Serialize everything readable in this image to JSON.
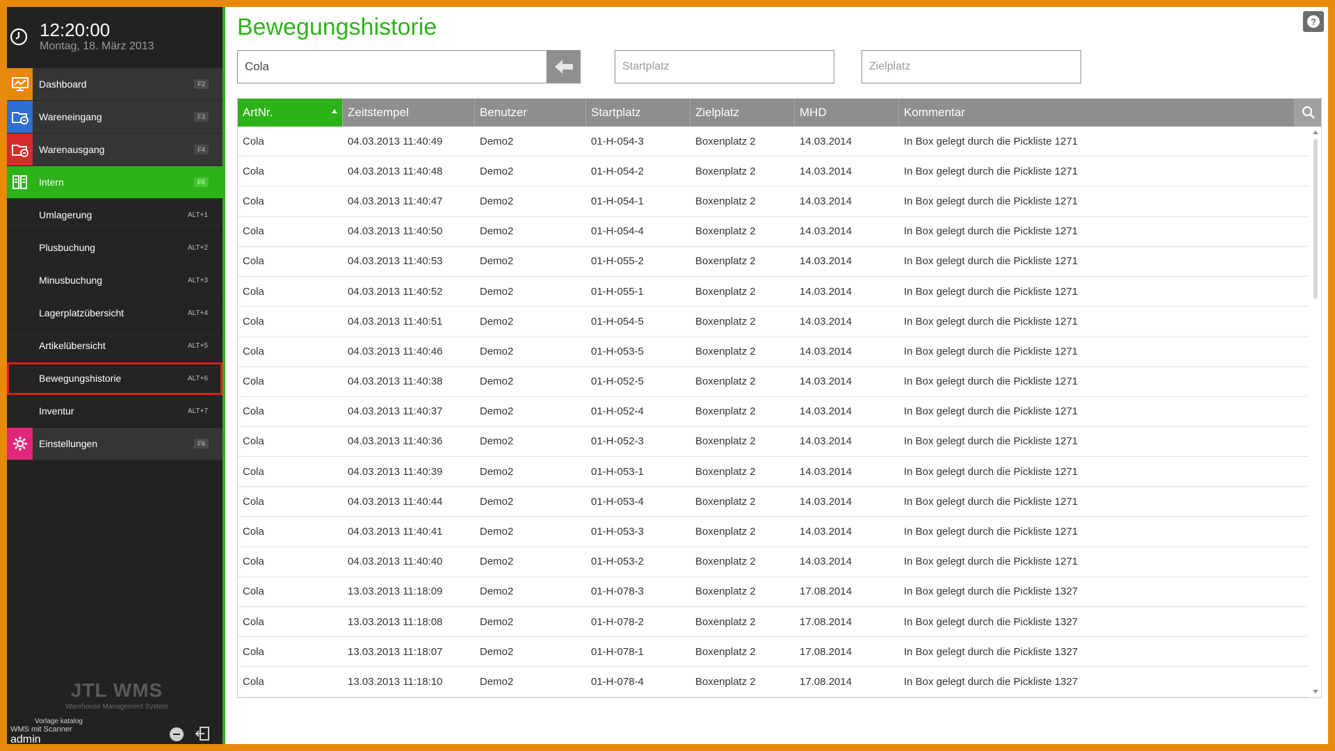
{
  "clock": {
    "time": "12:20:00",
    "date": "Montag, 18. März 2013"
  },
  "nav": {
    "items": [
      {
        "label": "Dashboard",
        "key": "F2",
        "icon": "dashboard-icon",
        "color": "#e8890c"
      },
      {
        "label": "Wareneingang",
        "key": "F3",
        "icon": "inbound-icon",
        "color": "#2f6fcf"
      },
      {
        "label": "Warenausgang",
        "key": "F4",
        "icon": "outbound-icon",
        "color": "#d62b2b"
      },
      {
        "label": "Intern",
        "key": "F5",
        "icon": "internal-icon",
        "color": "#2db21a"
      },
      {
        "label": "Umlagerung",
        "key": "ALT+1"
      },
      {
        "label": "Plusbuchung",
        "key": "ALT+2"
      },
      {
        "label": "Minusbuchung",
        "key": "ALT+3"
      },
      {
        "label": "Lagerplatzübersicht",
        "key": "ALT+4"
      },
      {
        "label": "Artikelübersicht",
        "key": "ALT+5"
      },
      {
        "label": "Bewegungshistorie",
        "key": "ALT+6"
      },
      {
        "label": "Inventur",
        "key": "ALT+7"
      },
      {
        "label": "Einstellungen",
        "key": "F6",
        "icon": "settings-icon",
        "color": "#e0267a"
      }
    ]
  },
  "logo": {
    "text": "JTL WMS",
    "subtitle": "Warehouse Management System"
  },
  "footer": {
    "line1": "Vorlage katalog",
    "line2": "WMS mit Scanner",
    "user": "admin"
  },
  "page": {
    "title": "Bewegungshistorie"
  },
  "filters": {
    "search_value": "Cola",
    "start_placeholder": "Startplatz",
    "target_placeholder": "Zielplatz"
  },
  "table": {
    "columns": [
      "ArtNr.",
      "Zeitstempel",
      "Benutzer",
      "Startplatz",
      "Zielplatz",
      "MHD",
      "Kommentar"
    ],
    "sorted_column": 0,
    "rows": [
      [
        "Cola",
        "04.03.2013 11:40:49",
        "Demo2",
        "01-H-054-3",
        "Boxenplatz 2",
        "14.03.2014",
        "In Box gelegt durch die Pickliste 1271"
      ],
      [
        "Cola",
        "04.03.2013 11:40:48",
        "Demo2",
        "01-H-054-2",
        "Boxenplatz 2",
        "14.03.2014",
        "In Box gelegt durch die Pickliste 1271"
      ],
      [
        "Cola",
        "04.03.2013 11:40:47",
        "Demo2",
        "01-H-054-1",
        "Boxenplatz 2",
        "14.03.2014",
        "In Box gelegt durch die Pickliste 1271"
      ],
      [
        "Cola",
        "04.03.2013 11:40:50",
        "Demo2",
        "01-H-054-4",
        "Boxenplatz 2",
        "14.03.2014",
        "In Box gelegt durch die Pickliste 1271"
      ],
      [
        "Cola",
        "04.03.2013 11:40:53",
        "Demo2",
        "01-H-055-2",
        "Boxenplatz 2",
        "14.03.2014",
        "In Box gelegt durch die Pickliste 1271"
      ],
      [
        "Cola",
        "04.03.2013 11:40:52",
        "Demo2",
        "01-H-055-1",
        "Boxenplatz 2",
        "14.03.2014",
        "In Box gelegt durch die Pickliste 1271"
      ],
      [
        "Cola",
        "04.03.2013 11:40:51",
        "Demo2",
        "01-H-054-5",
        "Boxenplatz 2",
        "14.03.2014",
        "In Box gelegt durch die Pickliste 1271"
      ],
      [
        "Cola",
        "04.03.2013 11:40:46",
        "Demo2",
        "01-H-053-5",
        "Boxenplatz 2",
        "14.03.2014",
        "In Box gelegt durch die Pickliste 1271"
      ],
      [
        "Cola",
        "04.03.2013 11:40:38",
        "Demo2",
        "01-H-052-5",
        "Boxenplatz 2",
        "14.03.2014",
        "In Box gelegt durch die Pickliste 1271"
      ],
      [
        "Cola",
        "04.03.2013 11:40:37",
        "Demo2",
        "01-H-052-4",
        "Boxenplatz 2",
        "14.03.2014",
        "In Box gelegt durch die Pickliste 1271"
      ],
      [
        "Cola",
        "04.03.2013 11:40:36",
        "Demo2",
        "01-H-052-3",
        "Boxenplatz 2",
        "14.03.2014",
        "In Box gelegt durch die Pickliste 1271"
      ],
      [
        "Cola",
        "04.03.2013 11:40:39",
        "Demo2",
        "01-H-053-1",
        "Boxenplatz 2",
        "14.03.2014",
        "In Box gelegt durch die Pickliste 1271"
      ],
      [
        "Cola",
        "04.03.2013 11:40:44",
        "Demo2",
        "01-H-053-4",
        "Boxenplatz 2",
        "14.03.2014",
        "In Box gelegt durch die Pickliste 1271"
      ],
      [
        "Cola",
        "04.03.2013 11:40:41",
        "Demo2",
        "01-H-053-3",
        "Boxenplatz 2",
        "14.03.2014",
        "In Box gelegt durch die Pickliste 1271"
      ],
      [
        "Cola",
        "04.03.2013 11:40:40",
        "Demo2",
        "01-H-053-2",
        "Boxenplatz 2",
        "14.03.2014",
        "In Box gelegt durch die Pickliste 1271"
      ],
      [
        "Cola",
        "13.03.2013 11:18:09",
        "Demo2",
        "01-H-078-3",
        "Boxenplatz 2",
        "17.08.2014",
        "In Box gelegt durch die Pickliste 1327"
      ],
      [
        "Cola",
        "13.03.2013 11:18:08",
        "Demo2",
        "01-H-078-2",
        "Boxenplatz 2",
        "17.08.2014",
        "In Box gelegt durch die Pickliste 1327"
      ],
      [
        "Cola",
        "13.03.2013 11:18:07",
        "Demo2",
        "01-H-078-1",
        "Boxenplatz 2",
        "17.08.2014",
        "In Box gelegt durch die Pickliste 1327"
      ],
      [
        "Cola",
        "13.03.2013 11:18:10",
        "Demo2",
        "01-H-078-4",
        "Boxenplatz 2",
        "17.08.2014",
        "In Box gelegt durch die Pickliste 1327"
      ]
    ]
  },
  "colors": {
    "accent": "#2db21a",
    "frame": "#e8890c",
    "highlight": "#e01b1b"
  }
}
